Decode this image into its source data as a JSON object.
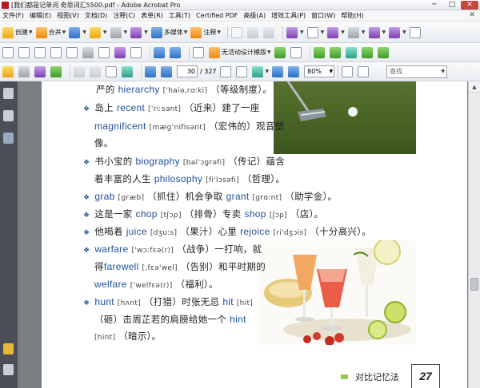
{
  "window": {
    "title": "[我们都是记单词 奇思词汇5500.pdf - Adobe Acrobat Pro",
    "buttons": {
      "minimize": "─",
      "maximize": "□",
      "close": "✕"
    }
  },
  "menu": {
    "items": [
      "文件(F)",
      "编辑(E)",
      "视图(V)",
      "文档(D)",
      "注释(C)",
      "表单(R)",
      "工具(T)",
      "Certified PDF",
      "高级(A)",
      "增效工具(P)",
      "窗口(W)",
      "帮助(H)"
    ],
    "close_doc": "✕"
  },
  "toolbar1": {
    "create_label": "创建",
    "combine_label": "合并",
    "multimedia_label": "多媒体",
    "comment_label": "注释"
  },
  "toolbar2": {
    "no_security_label": "无活动设计模版"
  },
  "toolbar3": {
    "current_page": "30",
    "total_pages": "/ 327",
    "zoom": "80%",
    "find_placeholder": "查找"
  },
  "content": {
    "l1": {
      "zh1": "严的",
      "en": "hierarchy",
      "ph": "['haiə,rɑːki]",
      "zh2": "（等级制度）。"
    },
    "l2": {
      "zh1": "岛上",
      "en": "recent",
      "ph": "['riːsənt]",
      "zh2": "（近来）建了一座"
    },
    "l3": {
      "en": "magnificent",
      "ph": "[mæg'nifisənt]",
      "zh2": "（宏伟的）观音塑"
    },
    "l4": {
      "zh1": "像。"
    },
    "l5": {
      "zh1": "书小宝的",
      "en": "biography",
      "ph": "[bai'ɔgrəfi]",
      "zh2": "（传记）蕴含"
    },
    "l6": {
      "zh1": "着丰富的人生",
      "en": "philosophy",
      "ph": "[fi'lɔsəfi]",
      "zh2": "（哲理）。"
    },
    "l7": {
      "en": "grab",
      "ph": "[græb]",
      "zh1": "（抓住）机会争取",
      "en2": "grant",
      "ph2": "[grɑːnt]",
      "zh2": "（助学金）。"
    },
    "l8": {
      "zh1": "这是一家",
      "en": "chop",
      "ph": "[tʃɔp]",
      "zh2": "（排骨）专卖",
      "en2": "shop",
      "ph2": "[ʃɔp]",
      "zh3": "（店）。"
    },
    "l9": {
      "zh1": "他喝着",
      "en": "juice",
      "ph": "[dʒuːs]",
      "zh2": "（果汁）心里",
      "en2": "rejoice",
      "ph2": "[ri'dʒɔis]",
      "zh3": "（十分高兴）。"
    },
    "l10": {
      "en": "warfare",
      "ph": "['wɔːfεə(r)]",
      "zh2": "（战争）一打响，就"
    },
    "l11": {
      "zh1": "得",
      "en": "farewell",
      "ph": "[,fεə'wel]",
      "zh2": "（告别）和平时期的"
    },
    "l12": {
      "en": "welfare",
      "ph": "['welfεə(r)]",
      "zh2": "（福利）。"
    },
    "l13": {
      "en": "hunt",
      "ph": "[hʌnt]",
      "zh1": "（打猎）时张无忌",
      "en2": "hit",
      "ph2": "[hit]"
    },
    "l14": {
      "zh1": "（砸）击周芷若的肩膀给她一个",
      "en": "hint"
    },
    "l15": {
      "ph": "[hint]",
      "zh2": "（暗示）。"
    },
    "footer": "对比记忆法",
    "page_number": "27"
  },
  "colors": {
    "accent_english": "#1f4f9c",
    "nav_pane": "#4b4f55",
    "doc_background": "#7a7d82",
    "footer_mark": "#9bc94a"
  }
}
